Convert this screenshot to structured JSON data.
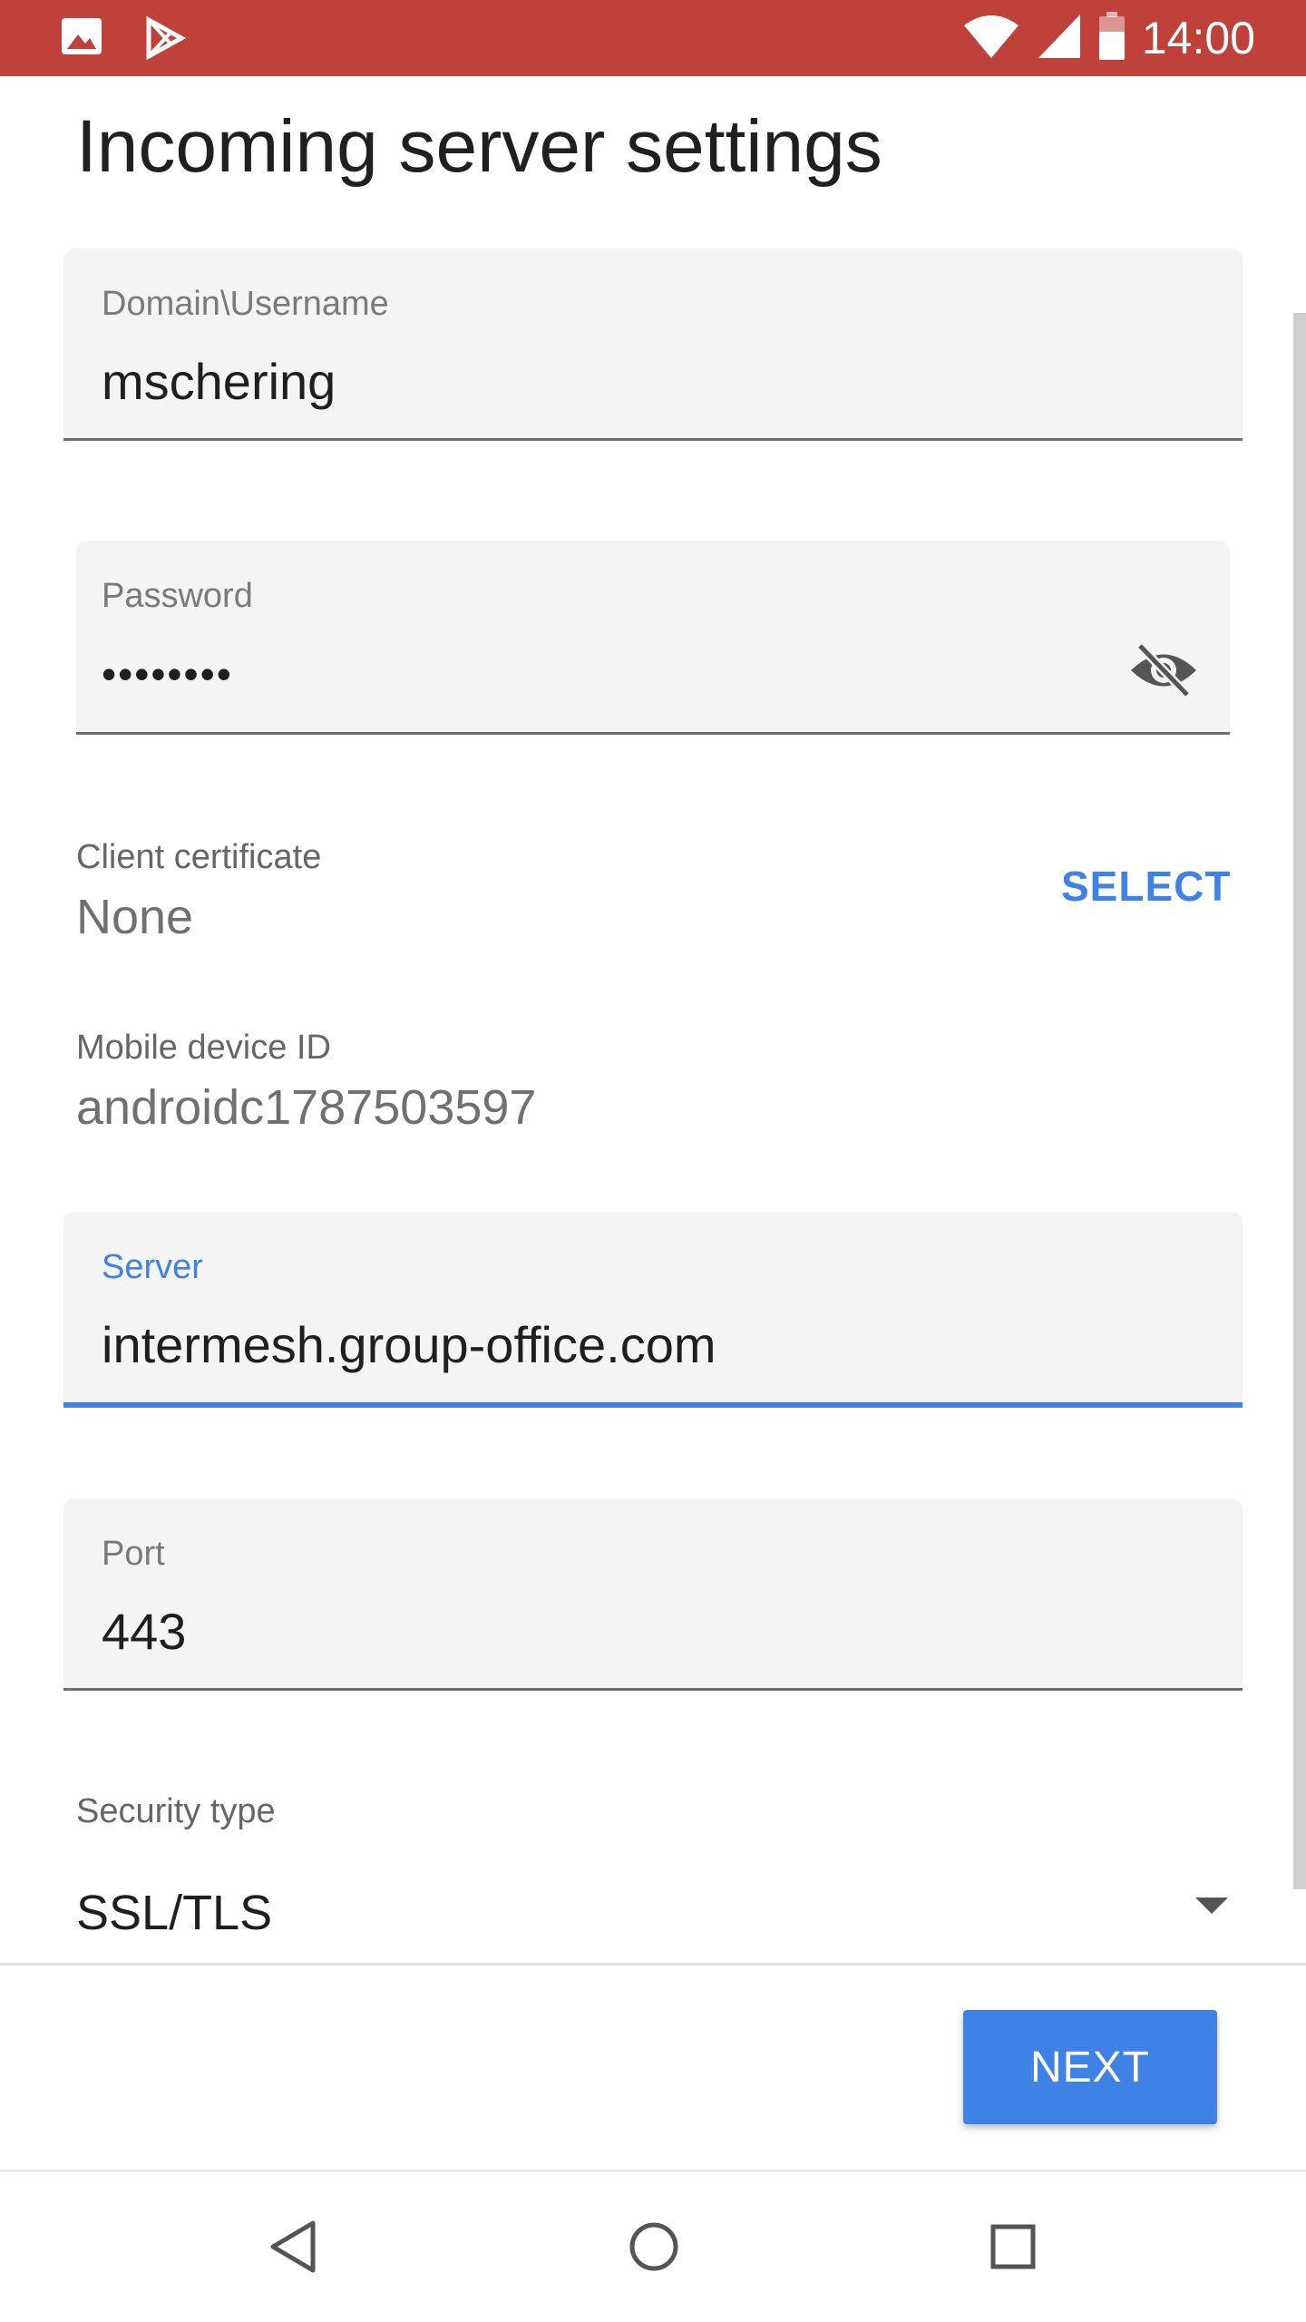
{
  "status_bar": {
    "time": "14:00",
    "left_icons": [
      "image-icon",
      "play-store-icon"
    ],
    "right_icons": [
      "wifi-icon",
      "signal-icon",
      "battery-icon"
    ],
    "background_color": "#c0403a"
  },
  "page": {
    "title": "Incoming server settings"
  },
  "fields": {
    "username": {
      "label": "Domain\\Username",
      "value": "mschering"
    },
    "password": {
      "label": "Password",
      "value": "••••••••"
    },
    "server": {
      "label": "Server",
      "value": "intermesh.group-office.com"
    },
    "port": {
      "label": "Port",
      "value": "443"
    }
  },
  "client_certificate": {
    "label": "Client certificate",
    "value": "None",
    "select_label": "SELECT"
  },
  "mobile_device": {
    "label": "Mobile device ID",
    "value": "androidc1787503597"
  },
  "security": {
    "label": "Security type",
    "value": "SSL/TLS"
  },
  "actions": {
    "next_label": "NEXT"
  },
  "colors": {
    "accent": "#3f82e6",
    "field_background": "#f4f4f4"
  }
}
